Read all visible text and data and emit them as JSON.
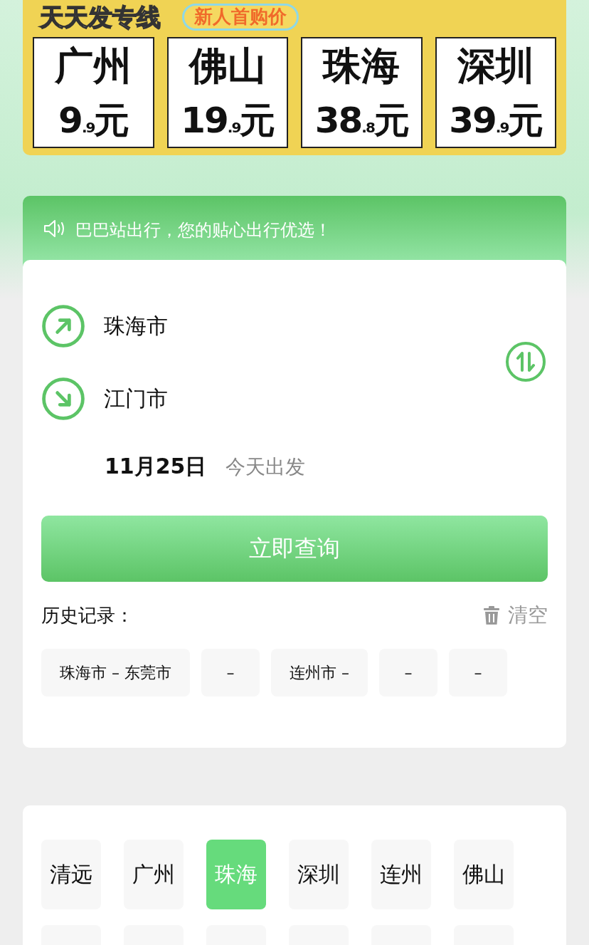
{
  "banner": {
    "title": "天天发专线",
    "tag": "新人首购价",
    "prices": [
      {
        "city": "广州",
        "price": "9$_{.9}$元"
      },
      {
        "city": "佛山",
        "price": "19$_{.9}$元"
      },
      {
        "city": "珠海",
        "price": "38$_{.8}$元"
      },
      {
        "city": "深圳",
        "price": "39$_{.9}$元"
      }
    ]
  },
  "notice": "巴巴站出行，您的贴心出行优选！",
  "route": {
    "from": "珠海市",
    "to": "江门市",
    "date": "11月25日",
    "date_note": "今天出发"
  },
  "search_button": "立即查询",
  "history": {
    "label": "历史记录：",
    "clear": "清空",
    "items": [
      "珠海市 – 东莞市",
      "–",
      "连州市 –",
      "–",
      "–"
    ]
  },
  "cities": [
    {
      "label": "清远",
      "selected": false
    },
    {
      "label": "广州",
      "selected": false
    },
    {
      "label": "珠海",
      "selected": true
    },
    {
      "label": "深圳",
      "selected": false
    },
    {
      "label": "连州",
      "selected": false
    },
    {
      "label": "佛山",
      "selected": false
    }
  ]
}
